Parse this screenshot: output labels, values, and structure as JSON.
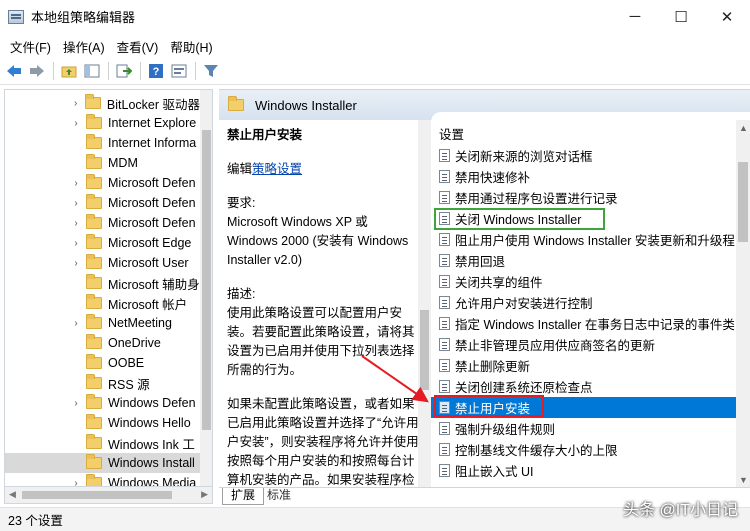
{
  "window": {
    "title": "本地组策略编辑器",
    "minimize_glyph": "─",
    "maximize_glyph": "☐",
    "close_glyph": "✕"
  },
  "menu": [
    "文件(F)",
    "操作(A)",
    "查看(V)",
    "帮助(H)"
  ],
  "toolbar": {
    "icons": [
      "back-icon",
      "forward-icon",
      "up-folder-icon",
      "show-hide-tree-icon",
      "export-list-icon",
      "help-icon",
      "properties-icon",
      "filter-icon"
    ]
  },
  "tree": {
    "items": [
      {
        "label": "BitLocker 驱动器",
        "expander": "›"
      },
      {
        "label": "Internet Explore",
        "expander": "›"
      },
      {
        "label": "Internet Informa",
        "expander": ""
      },
      {
        "label": "MDM",
        "expander": ""
      },
      {
        "label": "Microsoft Defen",
        "expander": "›"
      },
      {
        "label": "Microsoft Defen",
        "expander": "›"
      },
      {
        "label": "Microsoft Defen",
        "expander": "›"
      },
      {
        "label": "Microsoft Edge",
        "expander": "›"
      },
      {
        "label": "Microsoft User",
        "expander": "›"
      },
      {
        "label": "Microsoft 辅助身",
        "expander": ""
      },
      {
        "label": "Microsoft 帐户",
        "expander": ""
      },
      {
        "label": "NetMeeting",
        "expander": "›"
      },
      {
        "label": "OneDrive",
        "expander": ""
      },
      {
        "label": "OOBE",
        "expander": ""
      },
      {
        "label": "RSS 源",
        "expander": ""
      },
      {
        "label": "Windows Defen",
        "expander": "›"
      },
      {
        "label": "Windows Hello",
        "expander": ""
      },
      {
        "label": "Windows Ink 工",
        "expander": ""
      },
      {
        "label": "Windows Install",
        "expander": "",
        "selected": true
      },
      {
        "label": "Windows Media",
        "expander": "›"
      }
    ]
  },
  "header": {
    "title": "Windows Installer"
  },
  "description": {
    "title": "禁止用户安装",
    "edit_prefix": "编辑",
    "edit_link": "策略设置",
    "requirements_label": "要求:",
    "requirements_text": "Microsoft Windows XP 或 Windows 2000 (安装有 Windows Installer v2.0)",
    "desc_label": "描述:",
    "desc_p1": "使用此策略设置可以配置用户安装。若要配置此策略设置，请将其设置为已启用并使用下拉列表选择所需的行为。",
    "desc_p2": "如果未配置此策略设置，或者如果已启用此策略设置并选择了“允许用户安装”，则安装程序将允许并使用按照每个用户安装的和按照每台计算机安装的产品。如果安装程序检测到某个应用程序是按照每个用户"
  },
  "settings": {
    "column_header": "设置",
    "items": [
      "关闭新来源的浏览对话框",
      "禁用快速修补",
      "禁用通过程序包设置进行记录",
      "关闭 Windows Installer",
      "阻止用户使用 Windows Installer 安装更新和升级程",
      "禁用回退",
      "关闭共享的组件",
      "允许用户对安装进行控制",
      "指定 Windows Installer 在事务日志中记录的事件类",
      "禁止非管理员应用供应商签名的更新",
      "禁止删除更新",
      "关闭创建系统还原检查点",
      "禁止用户安装",
      "强制升级组件规则",
      "控制基线文件缓存大小的上限",
      "阻止嵌入式 UI"
    ],
    "selected_index": 12
  },
  "tabs": [
    "扩展",
    "标准"
  ],
  "status": {
    "text": "23 个设置"
  },
  "watermark": "头条 @IT小日记",
  "colors": {
    "selection": "#0078d7",
    "green_highlight": "#3ea53b",
    "red_highlight": "#e51c23",
    "arrow": "#e51c23"
  }
}
